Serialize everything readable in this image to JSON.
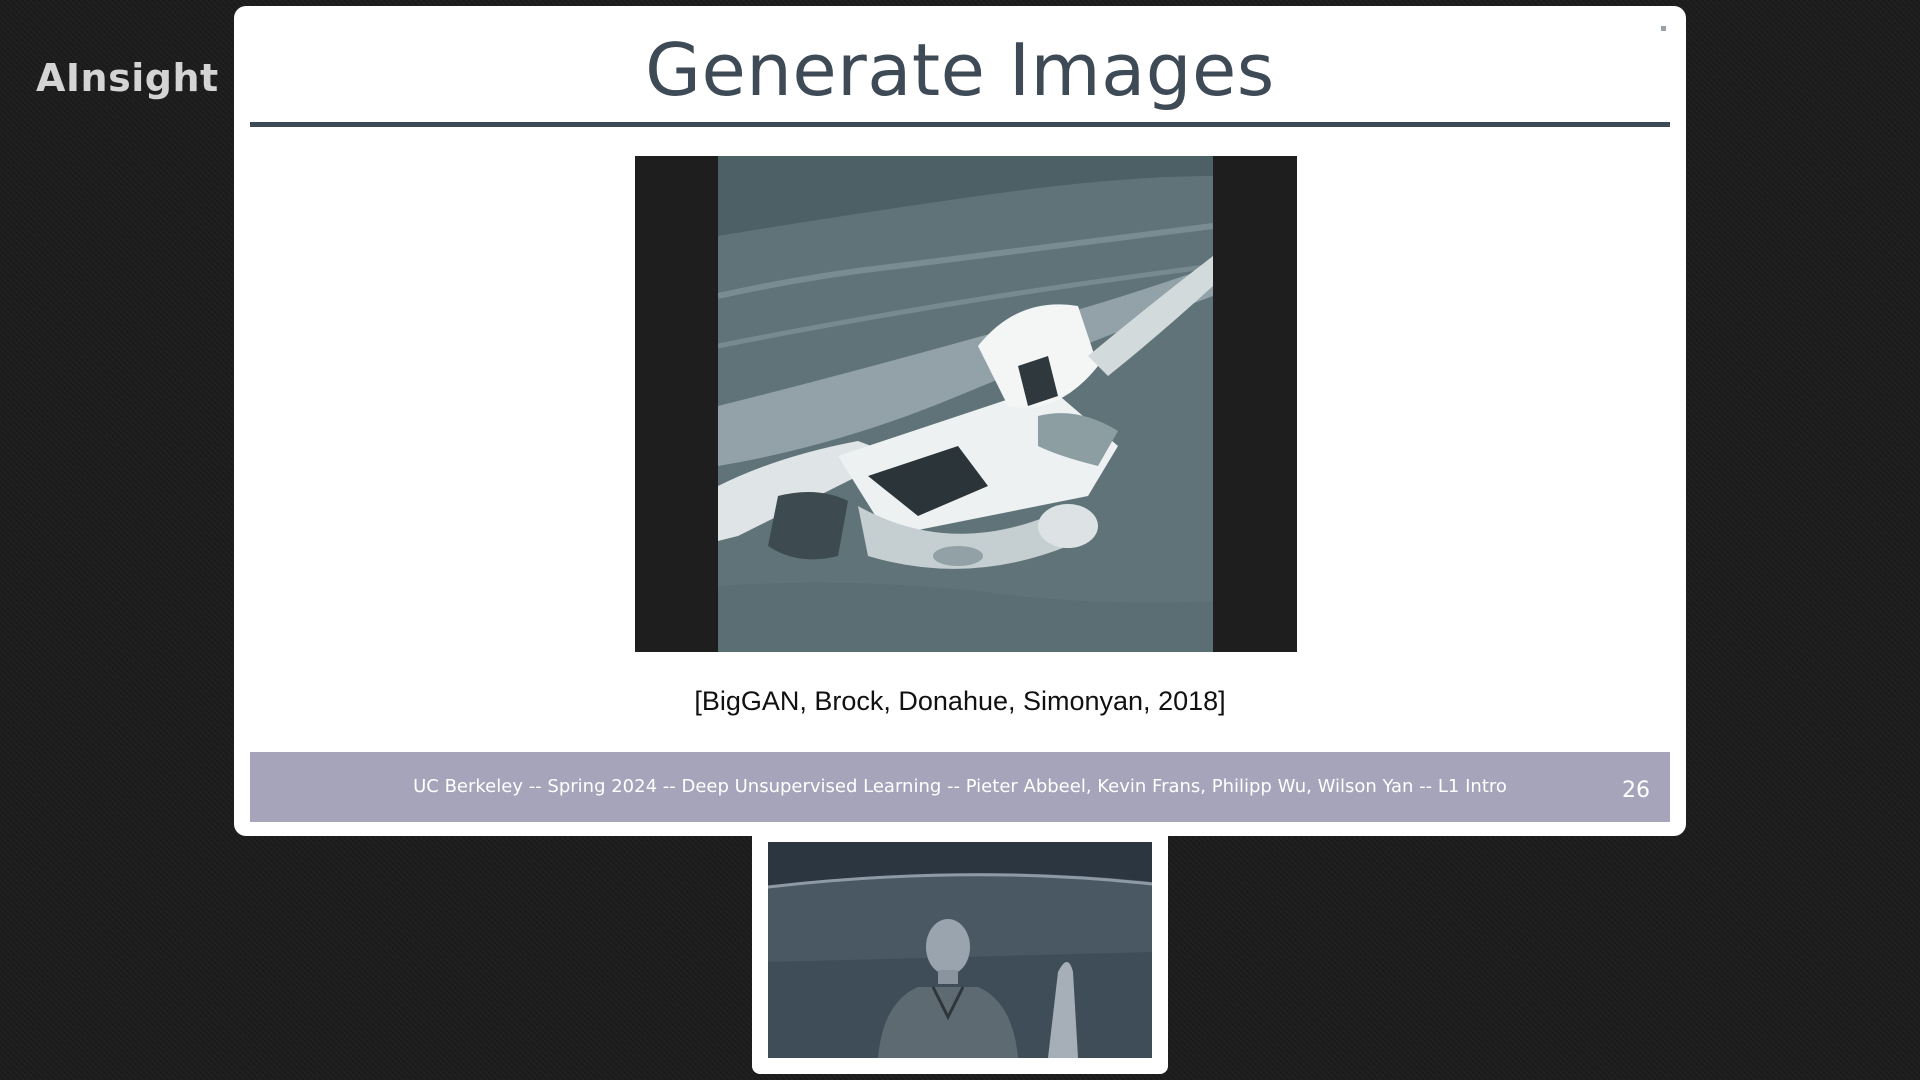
{
  "watermark": {
    "text": "AInsight",
    "logo_icon": "bilibili-logo-icon"
  },
  "slide": {
    "title": "Generate Images",
    "figure_icon": "biggan-generated-boat-image",
    "citation": "[BigGAN, Brock, Donahue, Simonyan, 2018]",
    "footer": "UC Berkeley -- Spring 2024 -- Deep Unsupervised Learning -- Pieter Abbeel, Kevin Frans, Philipp Wu, Wilson Yan -- L1 Intro",
    "page_number": "26"
  },
  "webcam": {
    "icon": "presenter-video-icon"
  },
  "colors": {
    "background": "#1c1c1c",
    "title": "#3e4a55",
    "rule": "#3b4a55",
    "footer_bar": "#a5a4bb",
    "image_water": "#5e7278"
  }
}
